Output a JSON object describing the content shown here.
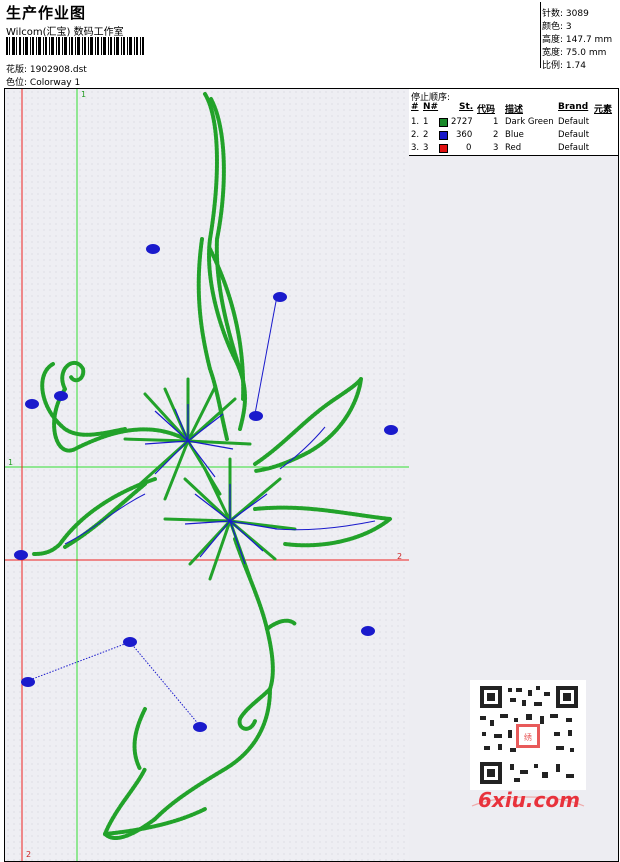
{
  "header": {
    "title": "生产作业图",
    "company": "Wilcom(汇宝) 数码工作室",
    "design_label": "花版:",
    "design_value": "1902908.dst",
    "colorway_label": "色位:",
    "colorway_value": "Colorway 1"
  },
  "stats": [
    {
      "label": "针数:",
      "value": "3089"
    },
    {
      "label": "颜色:",
      "value": "3"
    },
    {
      "label": "高度:",
      "value": "147.7 mm"
    },
    {
      "label": "宽度:",
      "value": "75.0 mm"
    },
    {
      "label": "比例:",
      "value": "1.74"
    }
  ],
  "stop_sequence": {
    "title": "停止顺序:",
    "headers": {
      "num": "#",
      "no": "N#",
      "stitches": "St.",
      "code": "代码",
      "desc": "描述",
      "brand": "Brand",
      "element": "元素"
    },
    "rows": [
      {
        "index": "1.",
        "no": "1",
        "stitches": "2727",
        "code": "1",
        "desc": "Dark Green",
        "brand": "Default",
        "color": "#1a8a2a"
      },
      {
        "index": "2.",
        "no": "2",
        "stitches": "360",
        "code": "2",
        "desc": "Blue",
        "brand": "Default",
        "color": "#1818c8"
      },
      {
        "index": "3.",
        "no": "3",
        "stitches": "0",
        "code": "3",
        "desc": "Red",
        "brand": "Default",
        "color": "#e01010"
      }
    ]
  },
  "guides": {
    "green_v_label": "1",
    "green_h_label": "1",
    "red_h_label": "2",
    "red_v_label": "2"
  },
  "watermark": {
    "text": "6xiu.com"
  },
  "colors": {
    "thread_green": "#22a22a",
    "thread_blue": "#1a1acc",
    "guide_green": "#33dd33",
    "guide_red": "#ee2222"
  }
}
